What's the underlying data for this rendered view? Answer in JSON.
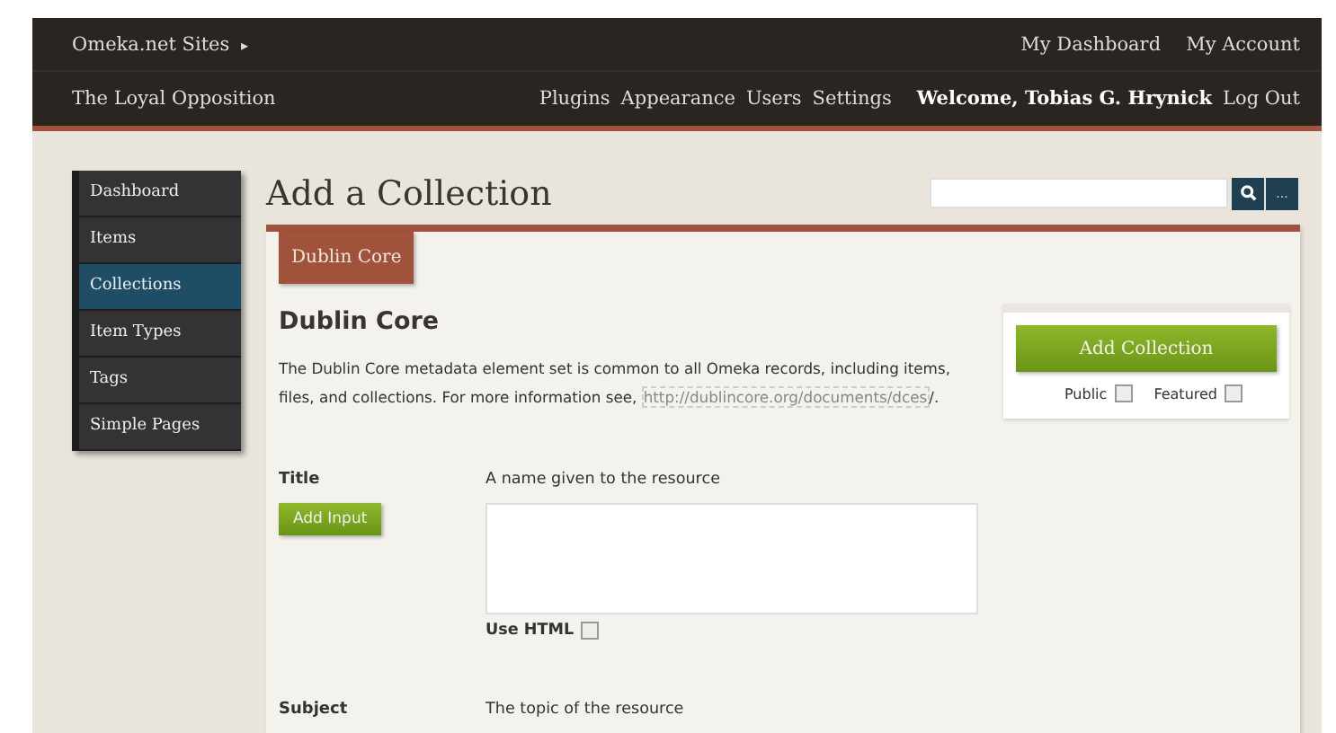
{
  "header": {
    "sites_menu": "Omeka.net Sites",
    "caret": "▸",
    "top_links": [
      "My Dashboard",
      "My Account"
    ],
    "site_title": "The Loyal Opposition",
    "nav": [
      "Plugins",
      "Appearance",
      "Users",
      "Settings"
    ],
    "welcome": "Welcome, Tobias G. Hrynick",
    "logout": "Log Out"
  },
  "sidebar": {
    "items": [
      {
        "label": "Dashboard",
        "selected": false
      },
      {
        "label": "Items",
        "selected": false
      },
      {
        "label": "Collections",
        "selected": true
      },
      {
        "label": "Item Types",
        "selected": false
      },
      {
        "label": "Tags",
        "selected": false
      },
      {
        "label": "Simple Pages",
        "selected": false
      }
    ]
  },
  "page_title": "Add a Collection",
  "search": {
    "more_button": "..."
  },
  "tabs": [
    {
      "label": "Dublin Core",
      "selected": true
    }
  ],
  "section": {
    "title": "Dublin Core",
    "intro": "The Dublin Core metadata element set is common to all Omeka records, including items, files, and collections. For more information see, ",
    "link": "http://dublincore.org/documents/dces",
    "after_link": "/."
  },
  "fields": [
    {
      "label": "Title",
      "description": "A name given to the resource",
      "add_button": "Add Input",
      "use_html": "Use HTML",
      "use_html_checked": false
    },
    {
      "label": "Subject",
      "description": "The topic of the resource"
    }
  ],
  "save_panel": {
    "button": "Add Collection",
    "options": [
      {
        "label": "Public",
        "checked": false
      },
      {
        "label": "Featured",
        "checked": false
      }
    ]
  }
}
